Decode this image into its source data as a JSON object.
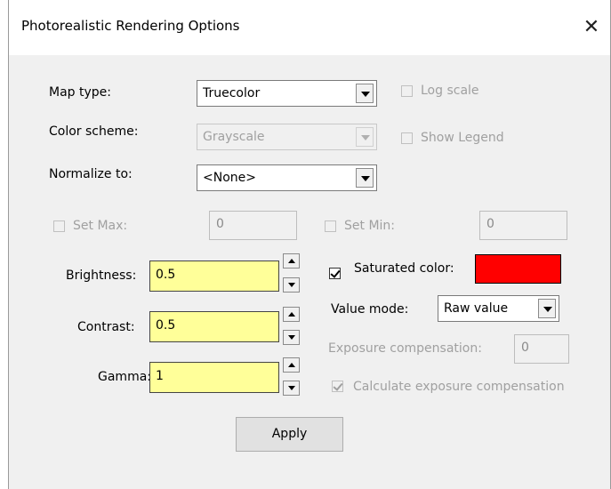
{
  "window": {
    "title": "Photorealistic Rendering Options",
    "close_glyph": "✕"
  },
  "map_type": {
    "label": "Map type:",
    "value": "Truecolor"
  },
  "color_scheme": {
    "label": "Color scheme:",
    "value": "Grayscale"
  },
  "normalize": {
    "label": "Normalize to:",
    "value": "<None>"
  },
  "log_scale": {
    "label": "Log scale",
    "checked": false
  },
  "show_legend": {
    "label": "Show Legend",
    "checked": false
  },
  "set_max": {
    "label": "Set Max:",
    "value": "0",
    "checked": false
  },
  "set_min": {
    "label": "Set Min:",
    "value": "0",
    "checked": false
  },
  "brightness": {
    "label": "Brightness:",
    "value": "0.5"
  },
  "contrast": {
    "label": "Contrast:",
    "value": "0.5"
  },
  "gamma": {
    "label": "Gamma:",
    "value": "1"
  },
  "saturated_color": {
    "label": "Saturated color:",
    "checked": true,
    "color": "#ff0000"
  },
  "value_mode": {
    "label": "Value mode:",
    "value": "Raw value"
  },
  "exposure": {
    "label": "Exposure compensation:",
    "value": "0"
  },
  "calc_exposure": {
    "label": "Calculate exposure compensation",
    "checked": true
  },
  "apply_label": "Apply"
}
